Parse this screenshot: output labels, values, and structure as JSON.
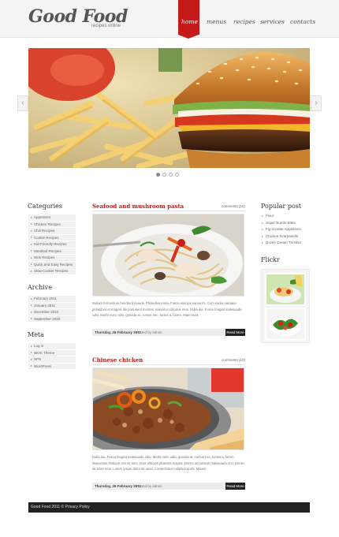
{
  "header": {
    "logo": "Good Food",
    "tagline": "recipes online",
    "nav": [
      "home",
      "menus",
      "recipes",
      "services",
      "contacts"
    ],
    "active_nav": "home",
    "accent_color": "#c41a1a"
  },
  "slider": {
    "prev_icon": "chevron-left-icon",
    "next_icon": "chevron-right-icon",
    "slide_count": 4,
    "active_slide": 1
  },
  "sidebar": {
    "categories_title": "Categories",
    "categories": [
      "Appetizers",
      "Chicken Recipes",
      "Chili Recipes",
      "Cookie Recipes",
      "Kid-Friendly Recipes",
      "Meatloaf Recipes",
      "Wok Recipes",
      "Quick and Easy Recipes",
      "Slow-Cooker Recipes"
    ],
    "archive_title": "Archive",
    "archive": [
      "February 2011",
      "January 2011",
      "december 2010",
      "September 2010"
    ],
    "meta_title": "Meta",
    "meta": [
      "Log in",
      "WOC Theme",
      "XFN",
      "WordPress"
    ]
  },
  "posts": [
    {
      "title": "Seafood and mushroom pasta",
      "comments": "comments (10)",
      "excerpt": "Nullam fermentum hendrerit mauris. Phasellus porta. Fusce suscipit varius mi. Cum sociis natoque penatibus et magnis dis parturient montes, nascetur ridiculus mus. Nulla dui. Fusce feugiat malesuada odio. Morbi nunc odio, gravida at, cursus nec, luctus a, lorem. Maecenas",
      "date": "Thursday, 26 February 2011",
      "author": "Posted by admin",
      "more": "Read More"
    },
    {
      "title": "Chinese chicken",
      "comments": "comments (10)",
      "excerpt": "Nulla dui. Fusce feugiat malesuada odio. Morbi nunc odio, gravida at, cursus nec, luctus a, lorem. Maecenas tristique orci ac sem. Duis ultricies pharetra magna. Donec accumsan malesuada orci. Donec sit amet eros. Lorem ipsum dolor sit amet, consectetuer adipiscing elit. Mauris",
      "date": "Thursday, 26 February 2011",
      "author": "Posted by admin",
      "more": "Read More"
    }
  ],
  "right": {
    "popular_title": "Popular post",
    "popular": [
      "Flour",
      "Super Burrito Bites",
      "Fig Arcatite Appetizers",
      "Chicken Scarpariello",
      "Dozen Cream Tin Mint"
    ],
    "flickr_title": "Flickr"
  },
  "footer": {
    "text": "Good Food 2011 © Privacy Policy"
  }
}
